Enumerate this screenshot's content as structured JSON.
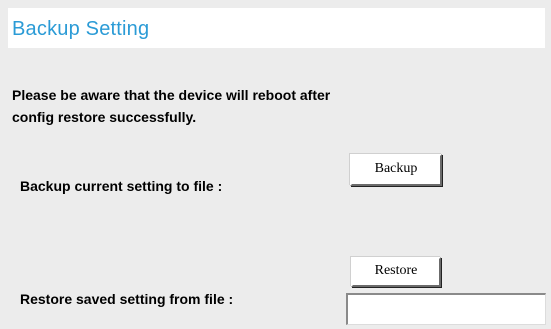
{
  "section": {
    "title": "Backup Setting"
  },
  "notice": {
    "line1": "Please be aware that the device will reboot after",
    "line2": "config restore successfully."
  },
  "backup": {
    "label": "Backup current setting to file :",
    "button_label": "Backup"
  },
  "restore": {
    "label": "Restore saved setting from file :",
    "button_label": "Restore",
    "file_value": ""
  },
  "colors": {
    "title": "#2b9bd6",
    "background": "#ececec"
  }
}
